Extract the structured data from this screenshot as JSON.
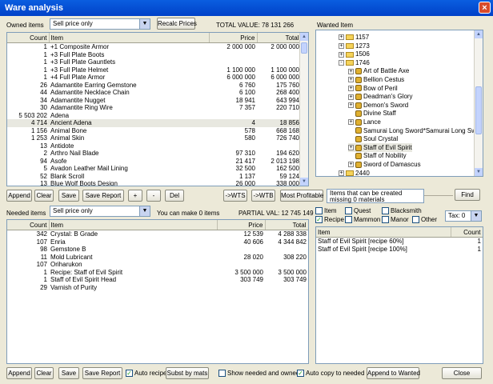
{
  "window": {
    "title": "Ware analysis",
    "close": "×"
  },
  "owned": {
    "label": "Owned items",
    "price_mode": "Sell price only",
    "recalc_label": "Recalc Prices",
    "total_label": "TOTAL VALUE: 78 131 266",
    "columns": [
      "Count",
      "Item",
      "Price",
      "Total"
    ],
    "rows": [
      {
        "count": "1",
        "item": "+1 Composite Armor",
        "price": "2 000 000",
        "total": "2 000 000"
      },
      {
        "count": "1",
        "item": "+3 Full Plate Boots",
        "price": "",
        "total": ""
      },
      {
        "count": "1",
        "item": "+3 Full Plate Gauntlets",
        "price": "",
        "total": ""
      },
      {
        "count": "1",
        "item": "+3 Full Plate Helmet",
        "price": "1 100 000",
        "total": "1 100 000"
      },
      {
        "count": "1",
        "item": "+4 Full Plate Armor",
        "price": "6 000 000",
        "total": "6 000 000"
      },
      {
        "count": "26",
        "item": "Adamantite Earring Gemstone",
        "price": "6 760",
        "total": "175 760"
      },
      {
        "count": "44",
        "item": "Adamantite Necklace Chain",
        "price": "6 100",
        "total": "268 400"
      },
      {
        "count": "34",
        "item": "Adamantite Nugget",
        "price": "18 941",
        "total": "643 994"
      },
      {
        "count": "30",
        "item": "Adamantite Ring Wire",
        "price": "7 357",
        "total": "220 710"
      },
      {
        "count": "5 503 202",
        "item": "Adena",
        "price": "",
        "total": ""
      },
      {
        "count": "4 714",
        "item": "Ancient Adena",
        "price": "4",
        "total": "18 856"
      },
      {
        "count": "1 156",
        "item": "Animal Bone",
        "price": "578",
        "total": "668 168"
      },
      {
        "count": "1 253",
        "item": "Animal Skin",
        "price": "580",
        "total": "726 740"
      },
      {
        "count": "13",
        "item": "Antidote",
        "price": "",
        "total": ""
      },
      {
        "count": "2",
        "item": "Arthro Nail Blade",
        "price": "97 310",
        "total": "194 620"
      },
      {
        "count": "94",
        "item": "Asofe",
        "price": "21 417",
        "total": "2 013 198"
      },
      {
        "count": "5",
        "item": "Avadon Leather Mail Lining",
        "price": "32 500",
        "total": "162 500"
      },
      {
        "count": "52",
        "item": "Blank Scroll",
        "price": "1 137",
        "total": "59 124"
      },
      {
        "count": "13",
        "item": "Blue Wolf Boots Design",
        "price": "26 000",
        "total": "338 000"
      }
    ],
    "buttons": [
      "Append",
      "Clear",
      "Save",
      "Save Report",
      "+",
      "-",
      "Del",
      "->WTS",
      "->WTB",
      "Most Profitable"
    ]
  },
  "wanted": {
    "label": "Wanted Item",
    "tree": [
      {
        "level": 1,
        "exp": "+",
        "label": "1157",
        "kind": "folder"
      },
      {
        "level": 1,
        "exp": "+",
        "label": "1273",
        "kind": "folder"
      },
      {
        "level": 1,
        "exp": "+",
        "label": "1506",
        "kind": "folder"
      },
      {
        "level": 1,
        "exp": "-",
        "label": "1746",
        "kind": "folder-open"
      },
      {
        "level": 2,
        "exp": "+",
        "label": "Art of Battle Axe",
        "kind": "item"
      },
      {
        "level": 2,
        "exp": "+",
        "label": "Bellion Cestus",
        "kind": "item"
      },
      {
        "level": 2,
        "exp": "+",
        "label": "Bow of Peril",
        "kind": "item"
      },
      {
        "level": 2,
        "exp": "+",
        "label": "Deadman's Glory",
        "kind": "item"
      },
      {
        "level": 2,
        "exp": "+",
        "label": "Demon's Sword",
        "kind": "item"
      },
      {
        "level": 2,
        "exp": "",
        "label": "Divine Staff",
        "kind": "item"
      },
      {
        "level": 2,
        "exp": "+",
        "label": "Lance",
        "kind": "item"
      },
      {
        "level": 2,
        "exp": "",
        "label": "Samurai Long Sword*Samurai Long Sword",
        "kind": "item"
      },
      {
        "level": 2,
        "exp": "",
        "label": "Soul Crystal",
        "kind": "item"
      },
      {
        "level": 2,
        "exp": "+",
        "label": "Staff of Evil Spirit",
        "kind": "item",
        "selected": true
      },
      {
        "level": 2,
        "exp": "",
        "label": "Staff of Nobility",
        "kind": "item"
      },
      {
        "level": 2,
        "exp": "+",
        "label": "Sword of Damascus",
        "kind": "item"
      },
      {
        "level": 1,
        "exp": "+",
        "label": "2440",
        "kind": "folder"
      }
    ],
    "status_text": "Items that can be created missing 0 materials",
    "find_label": "Find",
    "filters": [
      {
        "label": "Item",
        "checked": false
      },
      {
        "label": "Quest",
        "checked": false
      },
      {
        "label": "Blacksmith",
        "checked": false
      },
      {
        "label": "Recipe",
        "checked": true
      },
      {
        "label": "Mammon",
        "checked": false
      },
      {
        "label": "Manor",
        "checked": false
      },
      {
        "label": "Other",
        "checked": false
      }
    ],
    "tax_label": "Tax: 0",
    "result_columns": [
      "Item",
      "Count"
    ],
    "results": [
      {
        "item": "Staff of Evil Spirit [recipe 60%]",
        "count": "1"
      },
      {
        "item": "Staff of Evil Spirit [recipe 100%]",
        "count": "1"
      }
    ]
  },
  "needed": {
    "label": "Needed items",
    "price_mode": "Sell price only",
    "make_label": "You can make 0 items",
    "partial_label": "PARTIAL VAL: 12 745 149",
    "columns": [
      "Count",
      "Item",
      "Price",
      "Total"
    ],
    "rows": [
      {
        "count": "342",
        "item": "Crystal: B Grade",
        "price": "12 539",
        "total": "4 288 338"
      },
      {
        "count": "107",
        "item": "Enria",
        "price": "40 606",
        "total": "4 344 842"
      },
      {
        "count": "98",
        "item": "Gemstone B",
        "price": "",
        "total": ""
      },
      {
        "count": "11",
        "item": "Mold Lubricant",
        "price": "28 020",
        "total": "308 220"
      },
      {
        "count": "107",
        "item": "Oriharukon",
        "price": "",
        "total": ""
      },
      {
        "count": "1",
        "item": "Recipe: Staff of Evil Spirit",
        "price": "3 500 000",
        "total": "3 500 000"
      },
      {
        "count": "1",
        "item": "Staff of Evil Spirit Head",
        "price": "303 749",
        "total": "303 749"
      },
      {
        "count": "29",
        "item": "Varnish of Purity",
        "price": "",
        "total": ""
      }
    ]
  },
  "bottom": {
    "append": "Append",
    "clear": "Clear",
    "save": "Save",
    "save_report": "Save Report",
    "auto_recipe": "Auto recipe",
    "subst": "Subst by mats",
    "show_needed": "Show needed and owned",
    "auto_copy": "Auto copy to needed",
    "append_wanted": "Append to Wanted",
    "close": "Close"
  }
}
